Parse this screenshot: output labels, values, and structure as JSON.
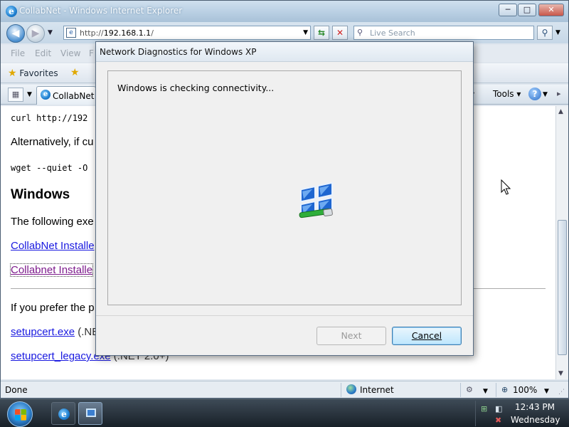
{
  "window": {
    "title": "CollabNet - Windows Internet Explorer",
    "minimize_label": "─",
    "maximize_label": "□",
    "close_label": "✕"
  },
  "address_bar": {
    "url_prefix": "http://",
    "url_host": "192.168.1.1",
    "url_suffix": "/",
    "search_placeholder": "Live Search"
  },
  "menu": {
    "items": [
      "File",
      "Edit",
      "View",
      "F"
    ]
  },
  "favorites_bar": {
    "favorites_label": "Favorites"
  },
  "tabs": {
    "active_tab_label": "CollabNet",
    "page_label": "▾",
    "tools_label": "Tools"
  },
  "content": {
    "line1": "curl http://192",
    "line2": "Alternatively, if cu",
    "line3": "wget --quiet -O",
    "heading": "Windows",
    "para": "The following exe",
    "link1": "CollabNet Installe",
    "link2": "Collabnet Installe",
    "para2": "If you prefer the p",
    "link3": "setupcert.exe",
    "link3_suffix": " (.NE",
    "link4": "setupcert_legacy.exe",
    "link4_suffix": " (.NET 2.0+)"
  },
  "status_bar": {
    "status_text": "Done",
    "zone_text": "Internet",
    "zoom_text": "100%"
  },
  "dialog": {
    "title": "Network Diagnostics for Windows XP",
    "status": "Windows is checking connectivity...",
    "next_label": "Next",
    "cancel_label": "Cancel"
  },
  "taskbar": {
    "time": "12:43 PM",
    "day": "Wednesday"
  },
  "icons": {
    "ie": "ie-logo-icon",
    "favorites": "star-icon",
    "network": "network-computers-icon",
    "start": "windows-flag-icon"
  }
}
